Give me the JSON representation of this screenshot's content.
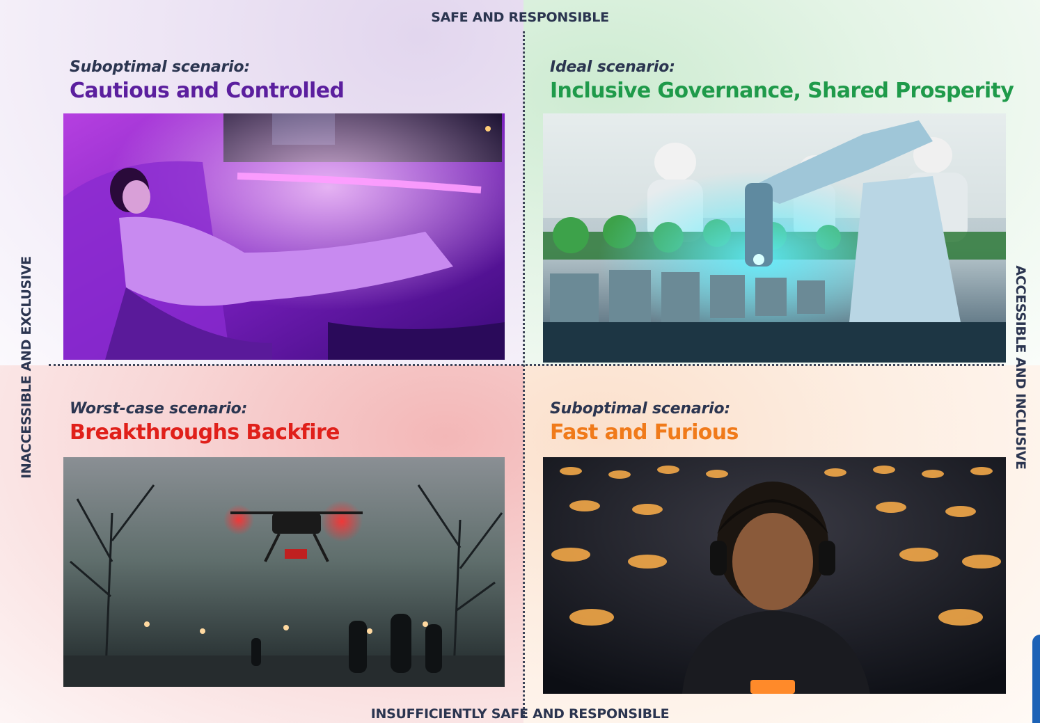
{
  "axes": {
    "top": "SAFE AND RESPONSIBLE",
    "bottom": "INSUFFICIENTLY SAFE AND RESPONSIBLE",
    "left": "INACCESSIBLE AND EXCLUSIVE",
    "right": "ACCESSIBLE AND INCLUSIVE"
  },
  "quadrants": {
    "top_left": {
      "kicker": "Suboptimal scenario:",
      "title": "Cautious and Controlled",
      "title_color": "#5b1f9e",
      "image": "woman-resting-in-autonomous-car"
    },
    "top_right": {
      "kicker": "Ideal scenario:",
      "title": "Inclusive Governance, Shared Prosperity",
      "title_color": "#1f9a4a",
      "image": "robotic-arm-lab-with-plants"
    },
    "bottom_left": {
      "kicker": "Worst-case scenario:",
      "title": "Breakthroughs Backfire",
      "title_color": "#e0201a",
      "image": "drone-over-foggy-park"
    },
    "bottom_right": {
      "kicker": "Suboptimal scenario:",
      "title": "Fast and Furious",
      "title_color": "#f07a1a",
      "image": "crowd-with-glowing-visors"
    }
  },
  "colors": {
    "axis_text": "#2b3550",
    "divider": "#3d4458",
    "edge_accent": "#1d62b6"
  }
}
